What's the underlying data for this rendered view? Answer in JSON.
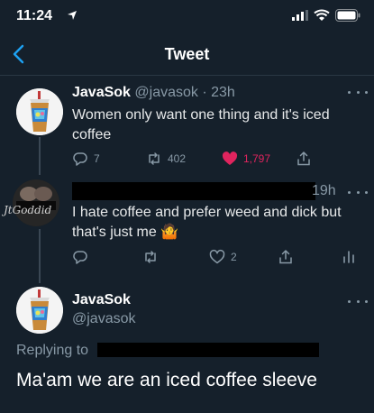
{
  "status_bar": {
    "time": "11:24"
  },
  "header": {
    "title": "Tweet"
  },
  "tweet1": {
    "name": "JavaSok",
    "handle": "@javasok",
    "time": "· 23h",
    "text": "Women only want one thing and it's iced coffee",
    "replies": "7",
    "retweets": "402",
    "likes": "1,797"
  },
  "tweet2": {
    "time": "19h",
    "avatar_text": "JtGoddid",
    "text": "I hate coffee and prefer weed and dick but that's just me 🤷",
    "likes": "2"
  },
  "tweet3": {
    "name": "JavaSok",
    "handle": "@javasok",
    "replying_to": "Replying to",
    "text": "Ma'am we are an iced coffee sleeve"
  },
  "colors": {
    "background": "#15202b",
    "accent": "#1da1f2",
    "like": "#e0245e",
    "muted": "#8899a6"
  }
}
